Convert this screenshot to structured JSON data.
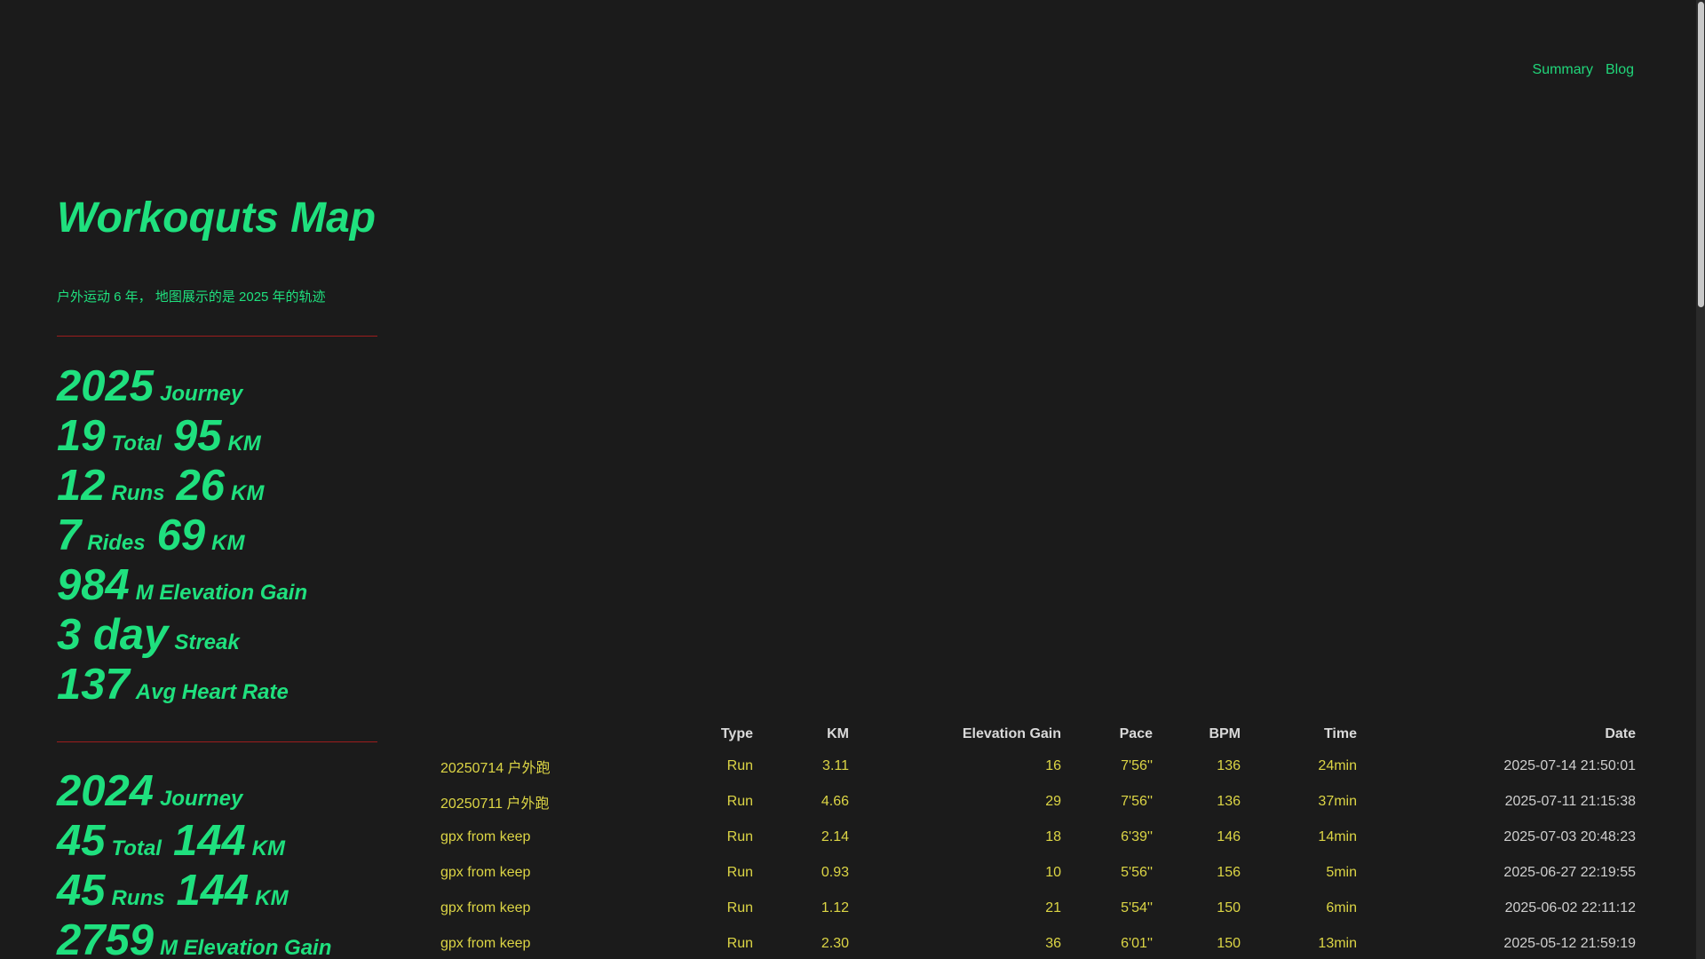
{
  "nav": {
    "summary": "Summary",
    "blog": "Blog"
  },
  "site": {
    "title": "Workoquts Map",
    "subtitle": "户外运动 6 年， 地图展示的是 2025 年的轨迹"
  },
  "years": [
    {
      "rows": [
        [
          {
            "n": "2025",
            "l": "Journey"
          }
        ],
        [
          {
            "n": "19",
            "l": "Total"
          },
          {
            "n": "95",
            "l": "KM"
          }
        ],
        [
          {
            "n": "12",
            "l": "Runs"
          },
          {
            "n": "26",
            "l": "KM"
          }
        ],
        [
          {
            "n": "7",
            "l": "Rides"
          },
          {
            "n": "69",
            "l": "KM"
          }
        ],
        [
          {
            "n": "984",
            "l": "M Elevation Gain"
          }
        ],
        [
          {
            "n": "3 day",
            "l": "Streak"
          }
        ],
        [
          {
            "n": "137",
            "l": "Avg Heart Rate"
          }
        ]
      ]
    },
    {
      "rows": [
        [
          {
            "n": "2024",
            "l": "Journey"
          }
        ],
        [
          {
            "n": "45",
            "l": "Total"
          },
          {
            "n": "144",
            "l": "KM"
          }
        ],
        [
          {
            "n": "45",
            "l": "Runs"
          },
          {
            "n": "144",
            "l": "KM"
          }
        ],
        [
          {
            "n": "2759",
            "l": "M Elevation Gain"
          }
        ]
      ]
    }
  ],
  "table": {
    "headers": {
      "name": "",
      "type": "Type",
      "km": "KM",
      "elevation": "Elevation Gain",
      "pace": "Pace",
      "bpm": "BPM",
      "time": "Time",
      "date": "Date"
    },
    "rows": [
      {
        "name": "20250714 户外跑",
        "type": "Run",
        "km": "3.11",
        "elevation": "16",
        "pace": "7'56''",
        "bpm": "136",
        "time": "24min",
        "date": "2025-07-14 21:50:01"
      },
      {
        "name": "20250711 户外跑",
        "type": "Run",
        "km": "4.66",
        "elevation": "29",
        "pace": "7'56''",
        "bpm": "136",
        "time": "37min",
        "date": "2025-07-11 21:15:38"
      },
      {
        "name": "gpx from keep",
        "type": "Run",
        "km": "2.14",
        "elevation": "18",
        "pace": "6'39''",
        "bpm": "146",
        "time": "14min",
        "date": "2025-07-03 20:48:23"
      },
      {
        "name": "gpx from keep",
        "type": "Run",
        "km": "0.93",
        "elevation": "10",
        "pace": "5'56''",
        "bpm": "156",
        "time": "5min",
        "date": "2025-06-27 22:19:55"
      },
      {
        "name": "gpx from keep",
        "type": "Run",
        "km": "1.12",
        "elevation": "21",
        "pace": "5'54''",
        "bpm": "150",
        "time": "6min",
        "date": "2025-06-02 22:11:12"
      },
      {
        "name": "gpx from keep",
        "type": "Run",
        "km": "2.30",
        "elevation": "36",
        "pace": "6'01''",
        "bpm": "150",
        "time": "13min",
        "date": "2025-05-12 21:59:19"
      }
    ]
  },
  "colors": {
    "background": "#1b1b1b",
    "accent": "#1fe07e",
    "table_value": "#dcd545",
    "divider": "#9c1d1d"
  }
}
